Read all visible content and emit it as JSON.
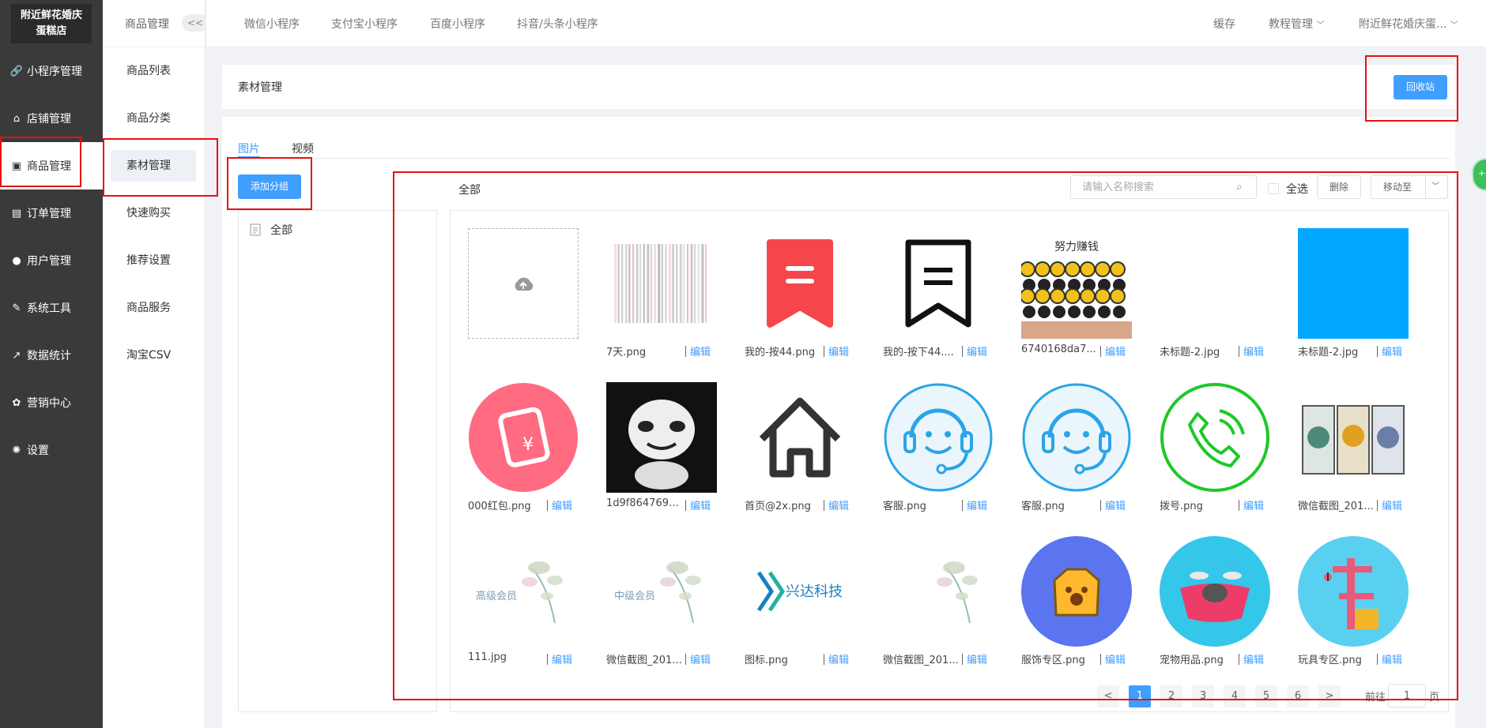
{
  "brand": {
    "line1": "附近鲜花婚庆",
    "line2": "蛋糕店"
  },
  "sidebar": {
    "items": [
      {
        "icon": "link-icon",
        "glyph": "🔗",
        "label": "小程序管理"
      },
      {
        "icon": "store-icon",
        "glyph": "⌂",
        "label": "店铺管理"
      },
      {
        "icon": "product-icon",
        "glyph": "▣",
        "label": "商品管理"
      },
      {
        "icon": "order-icon",
        "glyph": "▤",
        "label": "订单管理"
      },
      {
        "icon": "user-icon",
        "glyph": "●",
        "label": "用户管理"
      },
      {
        "icon": "wrench-icon",
        "glyph": "✎",
        "label": "系统工具"
      },
      {
        "icon": "chart-icon",
        "glyph": "↗",
        "label": "数据统计"
      },
      {
        "icon": "marketing-icon",
        "glyph": "✿",
        "label": "营销中心"
      },
      {
        "icon": "settings-icon",
        "glyph": "✺",
        "label": "设置"
      }
    ]
  },
  "subnav": {
    "title": "商品管理",
    "collapse": "<<",
    "items": [
      "商品列表",
      "商品分类",
      "素材管理",
      "快速购买",
      "推荐设置",
      "商品服务",
      "淘宝CSV"
    ]
  },
  "topbar": {
    "tabs": [
      "微信小程序",
      "支付宝小程序",
      "百度小程序",
      "抖音/头条小程序"
    ],
    "cache": "缓存",
    "tutorial": "教程管理",
    "shop": "附近鲜花婚庆蛋..."
  },
  "header": {
    "title": "素材管理",
    "recycle": "回收站"
  },
  "tabs": [
    "图片",
    "视频"
  ],
  "add_group": "添加分组",
  "groups": [
    "全部"
  ],
  "toolbar": {
    "current_group": "全部",
    "search_placeholder": "请输入名称搜索",
    "select_all": "全选",
    "delete": "删除",
    "move_to": "移动至"
  },
  "edit_label": "编辑",
  "media": [
    {
      "name": "",
      "kind": "upload"
    },
    {
      "name": "7天.png",
      "kind": "barcode"
    },
    {
      "name": "我的-按44.png",
      "kind": "bookmark-red"
    },
    {
      "name": "我的-按下44....",
      "kind": "bookmark-outline"
    },
    {
      "name": "6740168da7...",
      "kind": "meme-money",
      "caption": "努力赚钱"
    },
    {
      "name": "未标题-2.jpg",
      "kind": "blank"
    },
    {
      "name": "未标题-2.jpg",
      "kind": "blue-square"
    },
    {
      "name": "000红包.png",
      "kind": "redpacket"
    },
    {
      "name": "1d9f8647693...",
      "kind": "panda-meme"
    },
    {
      "name": "首页@2x.png",
      "kind": "house"
    },
    {
      "name": "客服.png",
      "kind": "service-light"
    },
    {
      "name": "客服.png",
      "kind": "service-blue"
    },
    {
      "name": "拨号.png",
      "kind": "phone"
    },
    {
      "name": "微信截图_201...",
      "kind": "paintings"
    },
    {
      "name": "111.jpg",
      "kind": "flower",
      "caption": "高级会员"
    },
    {
      "name": "微信截图_201...",
      "kind": "flower",
      "caption": "中级会员"
    },
    {
      "name": "图标.png",
      "kind": "logo",
      "caption": "兴达科技"
    },
    {
      "name": "微信截图_201...",
      "kind": "flower",
      "caption": ""
    },
    {
      "name": "服饰专区.png",
      "kind": "clothes"
    },
    {
      "name": "宠物用品.png",
      "kind": "pet"
    },
    {
      "name": "玩具专区.png",
      "kind": "toy"
    }
  ],
  "pagination": {
    "prev": "<",
    "pages": [
      "1",
      "2",
      "3",
      "4",
      "5",
      "6"
    ],
    "next": ">",
    "goto": "前往",
    "page_value": "1",
    "page_suffix": "页"
  }
}
